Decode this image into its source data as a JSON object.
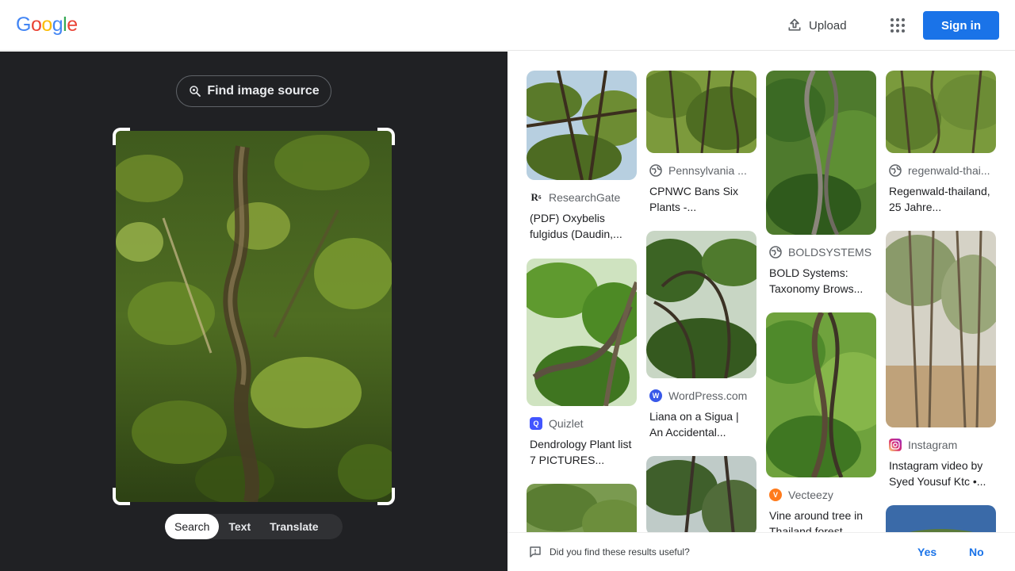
{
  "header": {
    "logo_letters": [
      {
        "ch": "G",
        "color": "#4285F4"
      },
      {
        "ch": "o",
        "color": "#EA4335"
      },
      {
        "ch": "o",
        "color": "#FBBC05"
      },
      {
        "ch": "g",
        "color": "#4285F4"
      },
      {
        "ch": "l",
        "color": "#34A853"
      },
      {
        "ch": "e",
        "color": "#EA4335"
      }
    ],
    "upload_label": "Upload",
    "apps_icon": "apps-grid-icon",
    "signin_label": "Sign in"
  },
  "left_pane": {
    "find_source_label": "Find image source",
    "modes": [
      {
        "label": "Search",
        "active": true
      },
      {
        "label": "Text",
        "active": false
      },
      {
        "label": "Translate",
        "active": false
      }
    ]
  },
  "results": [
    {
      "source": "ResearchGate",
      "title": "(PDF) Oxybelis fulgidus (Daudin,...",
      "favicon": "researchgate-icon"
    },
    {
      "source": "Quizlet",
      "title": "Dendrology Plant list 7 PICTURES...",
      "favicon": "quizlet-icon"
    },
    {
      "source": "Pennsylvania ...",
      "title": "CPNWC Bans Six Plants -...",
      "favicon": "globe-icon"
    },
    {
      "source": "WordPress.com",
      "title": "Liana on a Sigua | An Accidental...",
      "favicon": "wordpress-icon"
    },
    {
      "source": "BOLDSYSTEMS",
      "title": "BOLD Systems: Taxonomy Brows...",
      "favicon": "globe-icon"
    },
    {
      "source": "Vecteezy",
      "title": "Vine around tree in Thailand forest...",
      "favicon": "vecteezy-icon"
    },
    {
      "source": "regenwald-thai...",
      "title": "Regenwald-thailand, 25 Jahre...",
      "favicon": "globe-icon"
    },
    {
      "source": "Instagram",
      "title": "Instagram video by Syed Yousuf Ktc •...",
      "favicon": "instagram-icon"
    }
  ],
  "feedback": {
    "question": "Did you find these results useful?",
    "yes_label": "Yes",
    "no_label": "No"
  }
}
